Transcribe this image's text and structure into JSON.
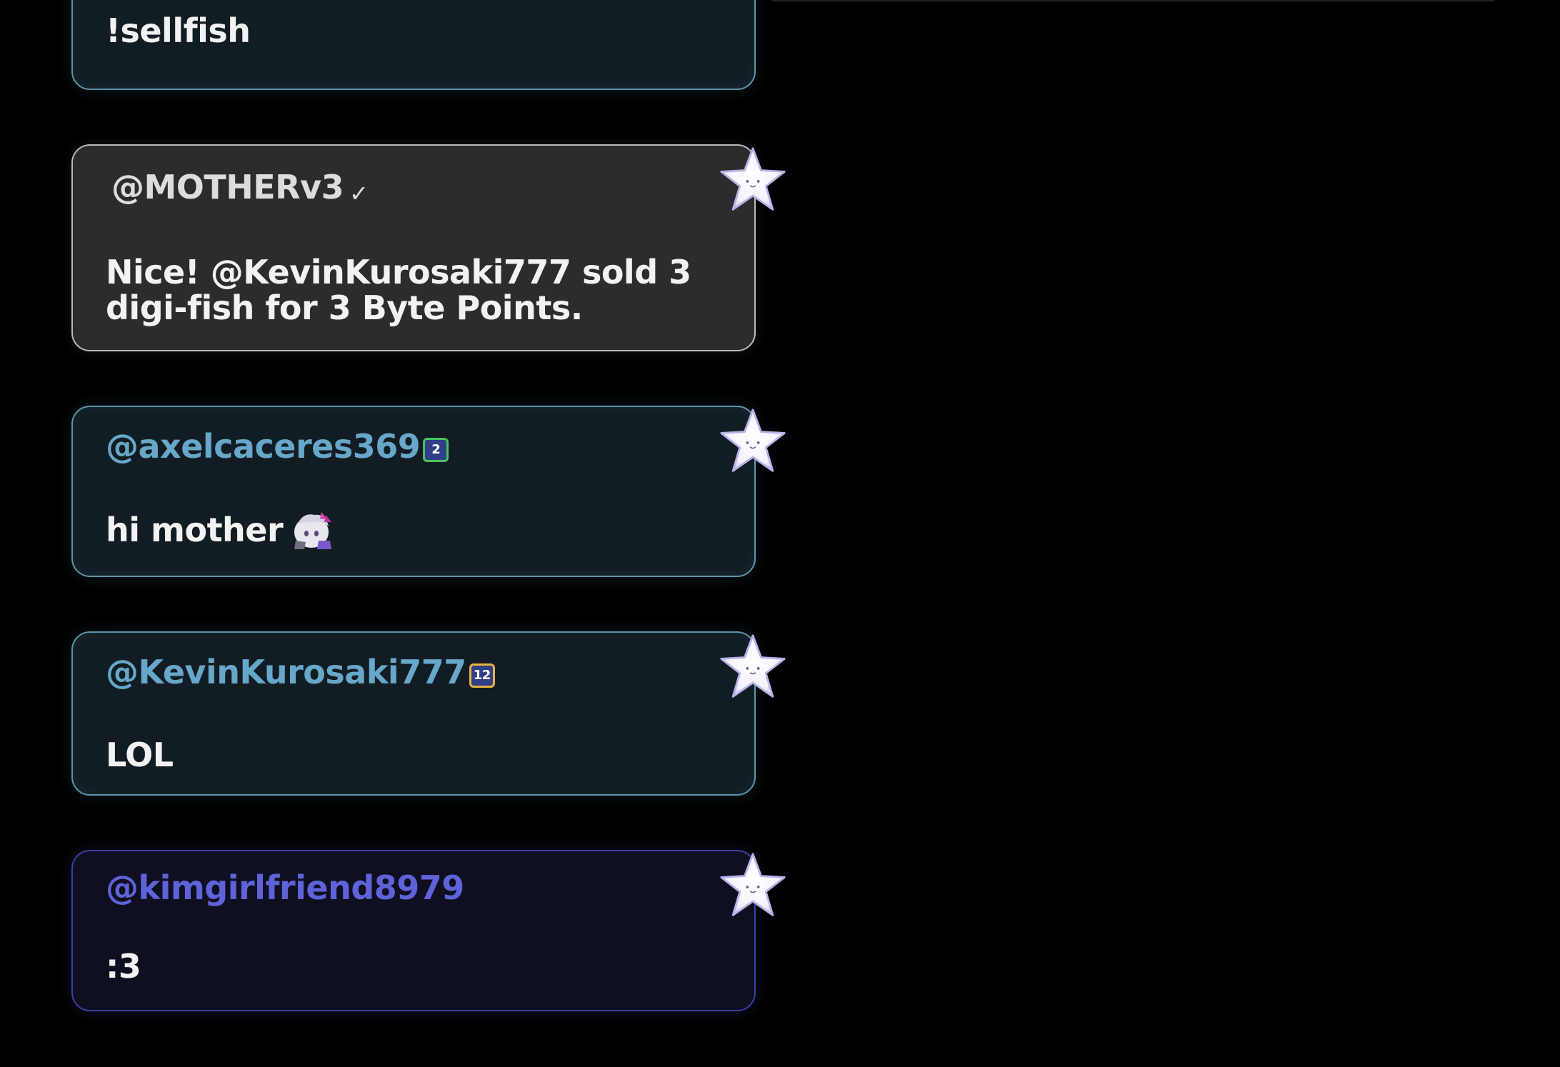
{
  "colors": {
    "background": "#000000",
    "user_name_blue": "#67a7c9",
    "user_name_purple": "#5f63d8",
    "card_border_blue": "#5c95ab",
    "card_border_system": "#b9b9b9",
    "card_border_purple": "#3a3fa2",
    "badge_green": "#4ac25c",
    "badge_gold": "#e7b440"
  },
  "messages": [
    {
      "text": "!sellfish"
    },
    {
      "user": "@MOTHERv3",
      "verified_icon": "checkmark-icon",
      "verified_mark": "✓",
      "text": "Nice! @KevinKurosaki777 sold 3 digi-fish for 3 Byte Points.",
      "star_icon": "star-icon"
    },
    {
      "user": "@axelcaceres369",
      "badge_icon": "subscriber-badge-icon",
      "badge_label": "2",
      "text": "hi mother",
      "emote_icon": "anime-girl-emote-icon",
      "star_icon": "star-icon"
    },
    {
      "user": "@KevinKurosaki777",
      "badge_icon": "subscriber-badge-icon",
      "badge_label": "12",
      "text": "LOL",
      "star_icon": "star-icon"
    },
    {
      "user": "@kimgirlfriend8979",
      "text": ":3",
      "star_icon": "star-icon"
    }
  ]
}
